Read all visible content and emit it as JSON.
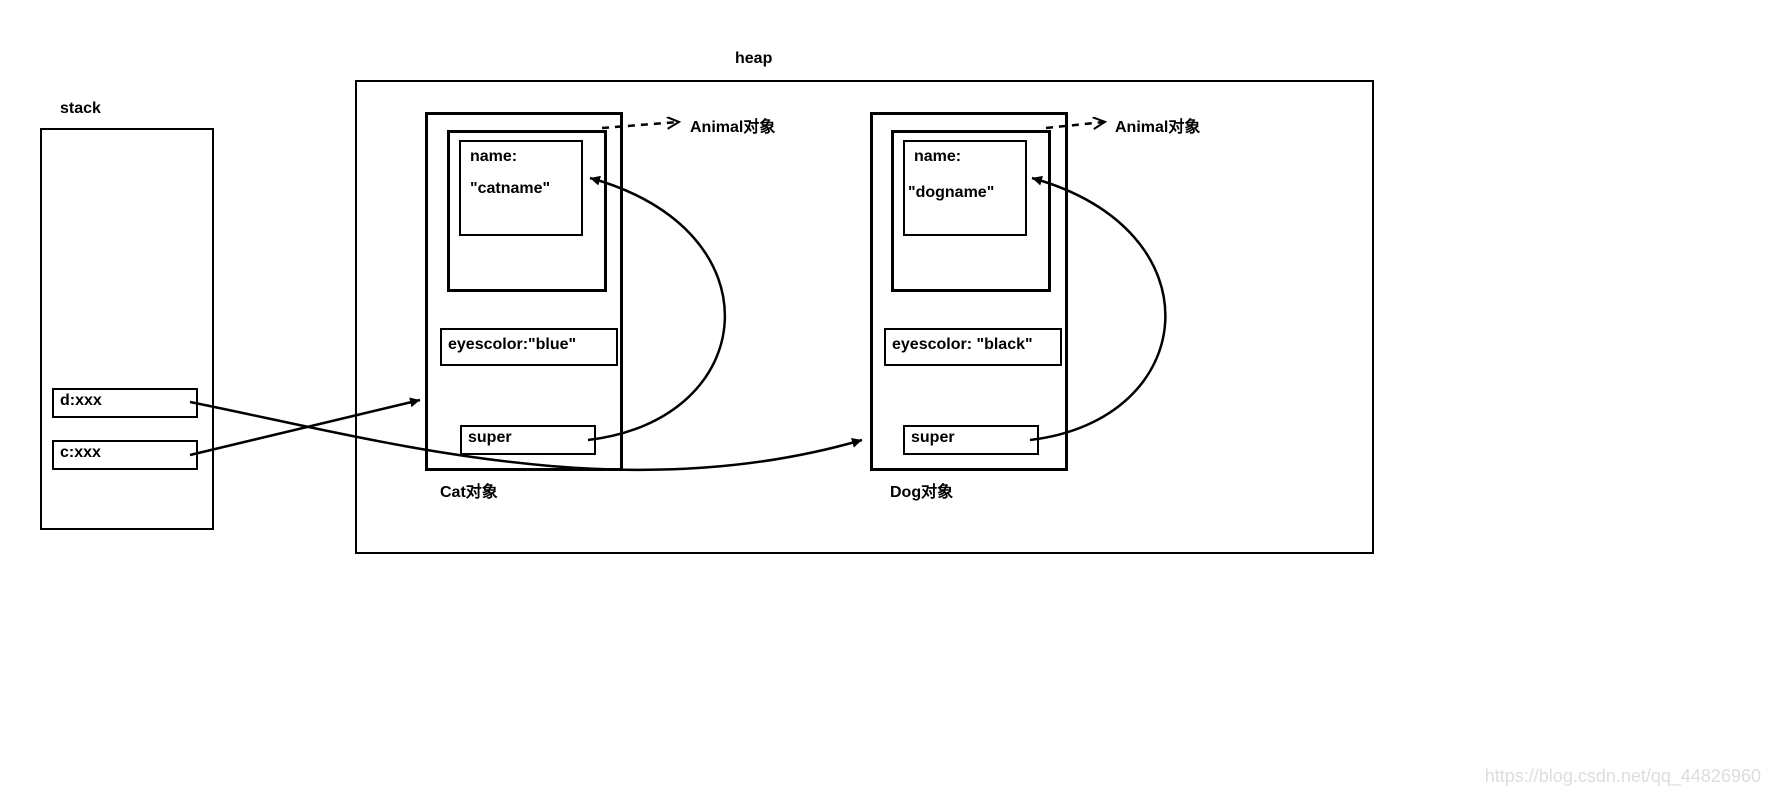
{
  "stack": {
    "title": "stack",
    "items": [
      {
        "label": "d:xxx"
      },
      {
        "label": "c:xxx"
      }
    ]
  },
  "heap": {
    "title": "heap",
    "objects": {
      "cat": {
        "label": "Cat对象",
        "animal_label": "Animal对象",
        "name_field": "name:",
        "name_value": "\"catname\"",
        "eyescolor": "eyescolor:\"blue\"",
        "super": "super"
      },
      "dog": {
        "label": "Dog对象",
        "animal_label": "Animal对象",
        "name_field": "name:",
        "name_value": "\"dogname\"",
        "eyescolor_label": "eyescolor:",
        "eyescolor_value": "\"black\"",
        "super": "super"
      }
    }
  },
  "watermark": "https://blog.csdn.net/qq_44826960"
}
